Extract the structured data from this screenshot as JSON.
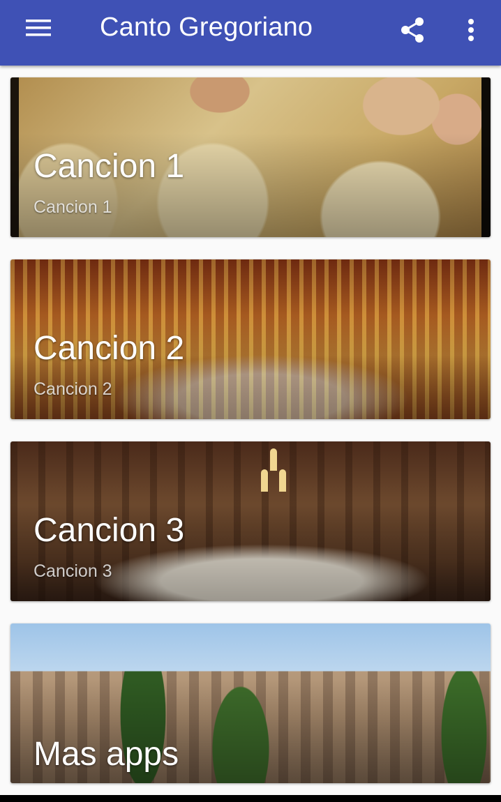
{
  "appbar": {
    "title": "Canto Gregoriano",
    "background": "#3f51b5",
    "menu_icon": "hamburger-menu-icon",
    "share_icon": "share-icon",
    "more_icon": "more-vertical-icon"
  },
  "cards": [
    {
      "title": "Cancion 1",
      "subtitle": "Cancion 1"
    },
    {
      "title": "Cancion 2",
      "subtitle": "Cancion 2"
    },
    {
      "title": "Cancion 3",
      "subtitle": "Cancion 3"
    },
    {
      "title": "Mas apps"
    }
  ]
}
